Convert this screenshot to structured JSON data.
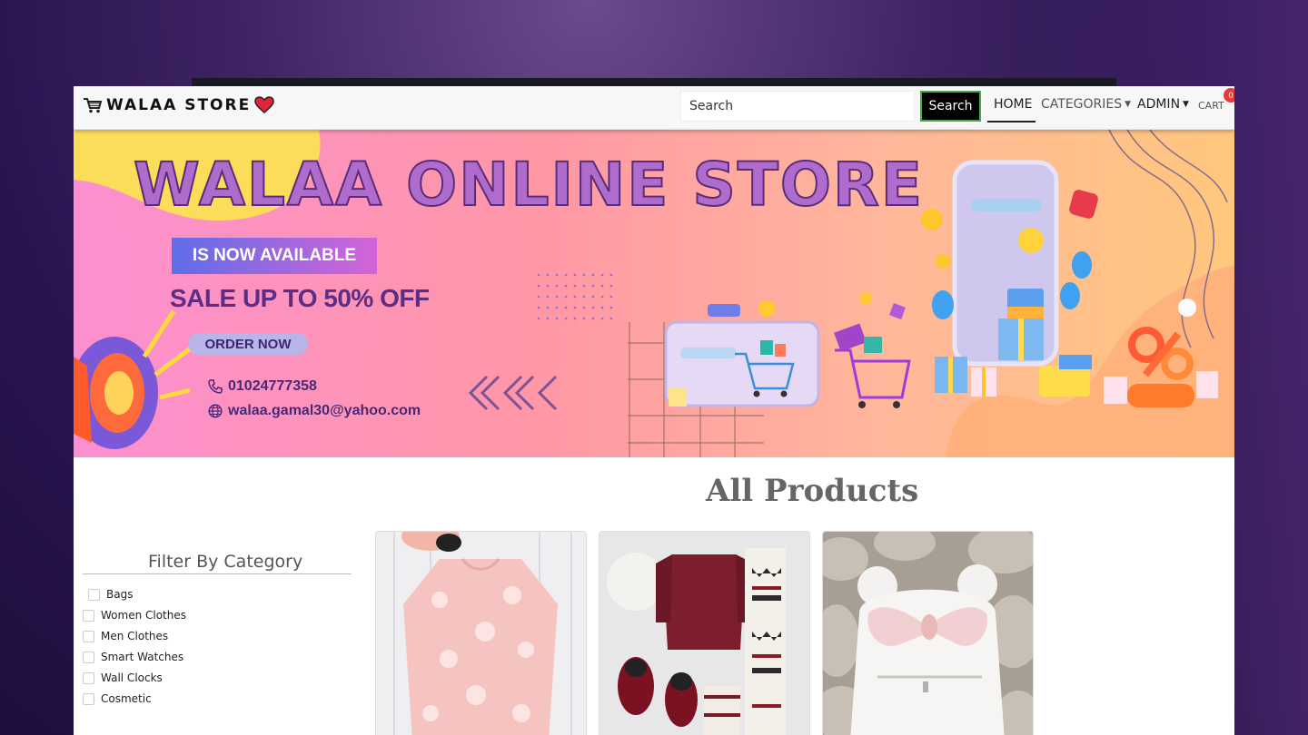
{
  "brand": {
    "name": "WALAA STORE"
  },
  "search": {
    "placeholder": "Search",
    "button_label": "Search"
  },
  "nav": {
    "home": "HOME",
    "categories": "CATEGORIES",
    "admin": "ADMIN",
    "cart": "CART",
    "cart_count": "0"
  },
  "banner": {
    "title": "WALAA ONLINE STORE",
    "badge": "IS NOW AVAILABLE",
    "sale": "SALE UP TO 50% OFF",
    "order_button": "ORDER NOW",
    "phone": "01024777358",
    "email": "walaa.gamal30@yahoo.com"
  },
  "products_section": {
    "title": "All Products"
  },
  "filter": {
    "title": "Filter By Category",
    "categories": [
      "Bags",
      "Women Clothes",
      "Men Clothes",
      "Smart Watches",
      "Wall Clocks",
      "Cosmetic"
    ]
  },
  "colors": {
    "nav_bg": "#f7f7f8",
    "search_button_bg": "#000000",
    "cart_badge": "#e83a3a",
    "banner_title": "#b06ccc"
  }
}
